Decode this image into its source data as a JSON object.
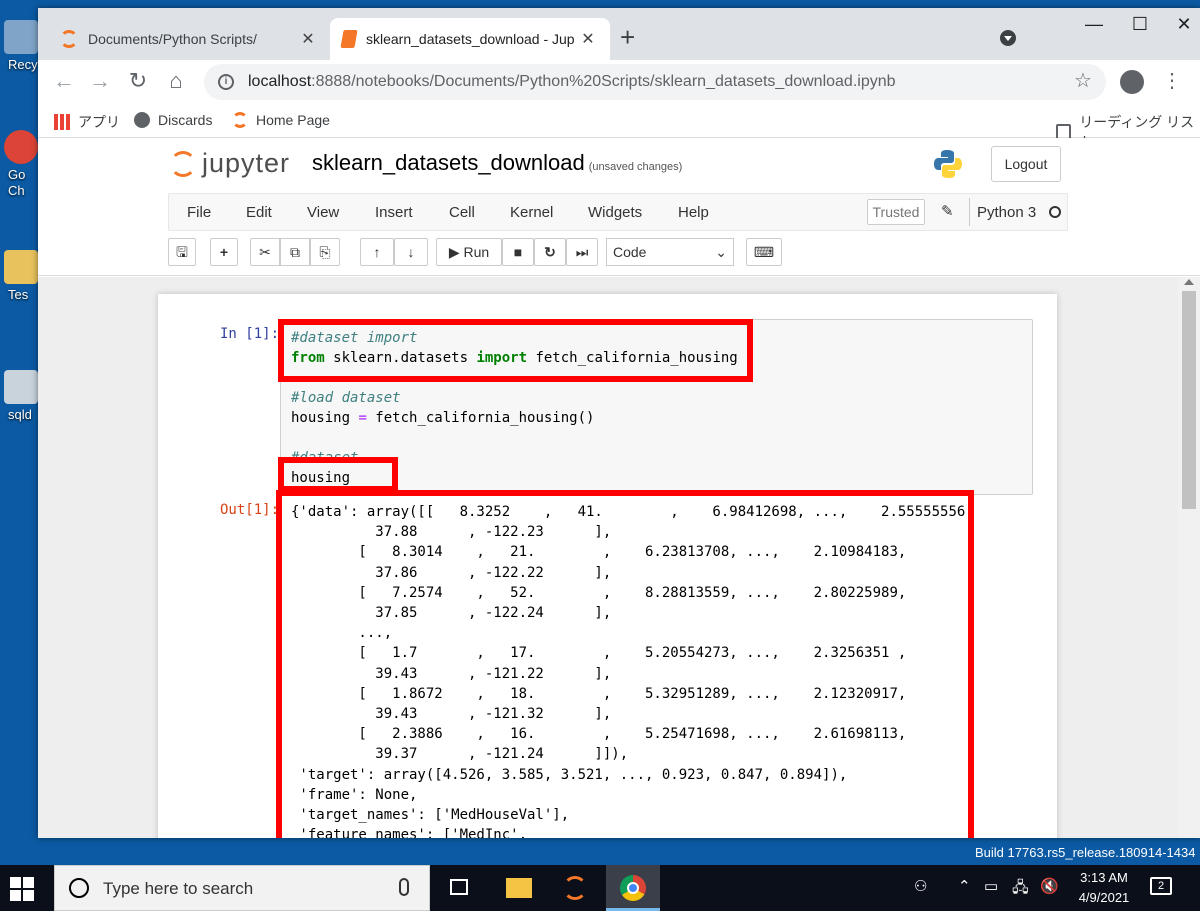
{
  "desktop": {
    "icons": [
      {
        "label": "Recy"
      },
      {
        "label": "Go\nCh"
      },
      {
        "label": "Tes"
      },
      {
        "label": "sqld"
      }
    ]
  },
  "browser": {
    "tabs": [
      {
        "title": "Documents/Python Scripts/",
        "close": "✕"
      },
      {
        "title": "sklearn_datasets_download - Jup",
        "close": "✕"
      }
    ],
    "new_tab": "+",
    "window_controls": {
      "minimize": "—",
      "maximize": "☐",
      "close": "✕"
    },
    "nav": {
      "back": "←",
      "forward": "→",
      "reload": "↻",
      "home": "⌂"
    },
    "url_host": "localhost",
    "url_path": ":8888/notebooks/Documents/Python%20Scripts/sklearn_datasets_download.ipynb",
    "star": "☆",
    "menu": "⋮",
    "bookmarks": [
      {
        "label": "アプリ",
        "icon": "apps-grid-icon"
      },
      {
        "label": "Discards",
        "icon": "globe-icon"
      },
      {
        "label": "Home Page",
        "icon": "jupyter-icon"
      }
    ],
    "reading_list": "リーディング リスト"
  },
  "jupyter": {
    "logo_text": "jupyter",
    "notebook_title": "sklearn_datasets_download",
    "unsaved": "(unsaved changes)",
    "logout": "Logout",
    "menu": [
      "File",
      "Edit",
      "View",
      "Insert",
      "Cell",
      "Kernel",
      "Widgets",
      "Help"
    ],
    "trusted": "Trusted",
    "kernel_name": "Python 3",
    "toolbar": {
      "save": "🖫",
      "add": "+",
      "cut": "✂",
      "copy": "⧉",
      "paste": "⎘",
      "up": "↑",
      "down": "↓",
      "run": "▶ Run",
      "stop": "■",
      "restart": "↻",
      "fastforward": "⏭",
      "cell_type": "Code",
      "keyboard": "⌨"
    },
    "cell": {
      "in_prompt": "In [1]:",
      "out_prompt": "Out[1]:",
      "code": {
        "c1": "#dataset import",
        "l2_kw1": "from",
        "l2_mid": " sklearn.datasets ",
        "l2_kw2": "import",
        "l2_end": " fetch_california_housing",
        "c2": "#load dataset",
        "l5_a": "housing ",
        "l5_op": "=",
        "l5_b": " fetch_california_housing()",
        "c3": "#dataset",
        "l8": "housing"
      },
      "output": "{'data': array([[   8.3252    ,   41.        ,    6.98412698, ...,    2.55555556,\n          37.88      , -122.23      ],\n        [   8.3014    ,   21.        ,    6.23813708, ...,    2.10984183,\n          37.86      , -122.22      ],\n        [   7.2574    ,   52.        ,    8.28813559, ...,    2.80225989,\n          37.85      , -122.24      ],\n        ...,\n        [   1.7       ,   17.        ,    5.20554273, ...,    2.3256351 ,\n          39.43      , -121.22      ],\n        [   1.8672    ,   18.        ,    5.32951289, ...,    2.12320917,\n          39.43      , -121.32      ],\n        [   2.3886    ,   16.        ,    5.25471698, ...,    2.61698113,\n          39.37      , -121.24      ]]),\n 'target': array([4.526, 3.585, 3.521, ..., 0.923, 0.847, 0.894]),\n 'frame': None,\n 'target_names': ['MedHouseVal'],\n 'feature_names': ['MedInc',"
    }
  },
  "windows": {
    "watermark": "Build 17763.rs5_release.180914-1434",
    "search_placeholder": "Type here to search",
    "time": "3:13 AM",
    "date": "4/9/2021",
    "notifications": "2"
  }
}
